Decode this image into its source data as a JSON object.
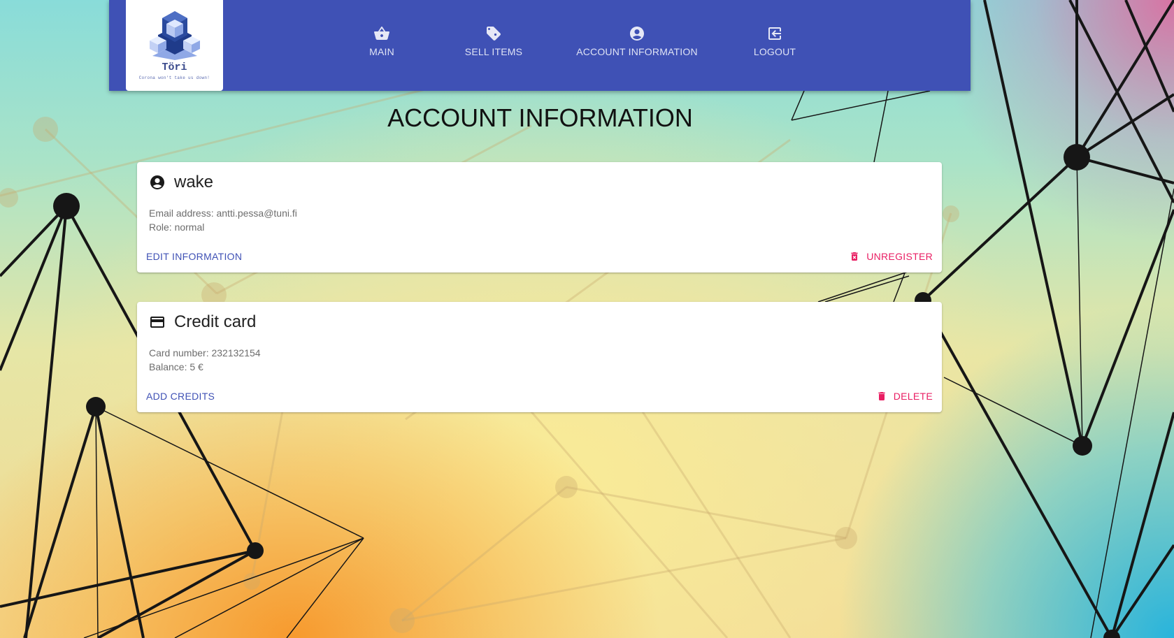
{
  "nav": {
    "logo": {
      "title": "Töri",
      "slogan": "Corona won't take us down!"
    },
    "items": [
      {
        "label": "MAIN",
        "icon": "basket-icon"
      },
      {
        "label": "SELL ITEMS",
        "icon": "tag-icon"
      },
      {
        "label": "ACCOUNT INFORMATION",
        "icon": "account-circle-icon"
      },
      {
        "label": "LOGOUT",
        "icon": "logout-icon"
      }
    ]
  },
  "page": {
    "title": "ACCOUNT INFORMATION"
  },
  "account_card": {
    "username": "wake",
    "email_line": "Email address: antti.pessa@tuni.fi",
    "role_line": "Role: normal",
    "edit_label": "EDIT INFORMATION",
    "unregister_label": "UNREGISTER",
    "icon": "account-circle-icon"
  },
  "credit_card": {
    "title": "Credit card",
    "number_line": "Card number: 232132154",
    "balance_line": "Balance: 5 €",
    "add_label": "ADD CREDITS",
    "delete_label": "DELETE",
    "icon": "credit-card-icon"
  },
  "colors": {
    "primary": "#3f51b5",
    "danger": "#e91e63"
  }
}
